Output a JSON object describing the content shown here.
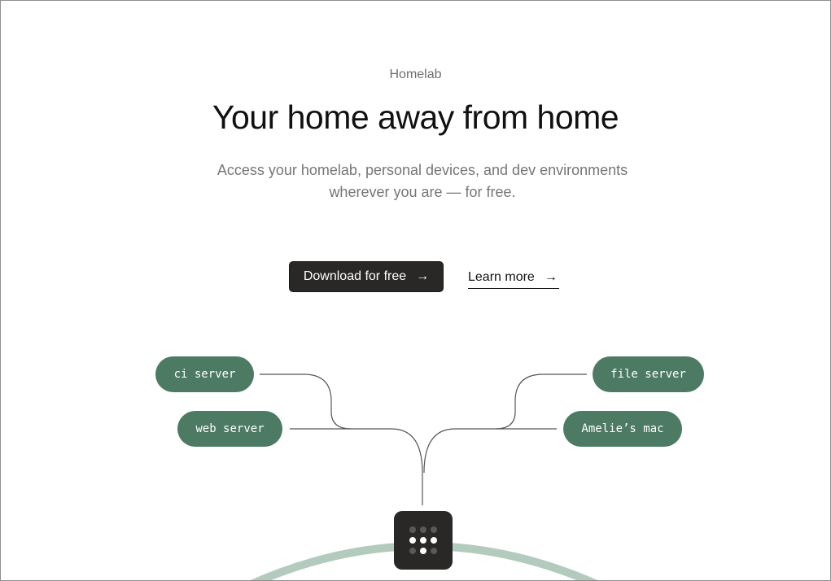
{
  "hero": {
    "eyebrow": "Homelab",
    "title": "Your home away from home",
    "subtitle": "Access your homelab, personal devices, and dev environments wherever you are — for free."
  },
  "actions": {
    "download_label": "Download for free",
    "learn_label": "Learn more",
    "arrow_icon": "arrow-right-icon"
  },
  "network": {
    "nodes": [
      {
        "label": "ci server",
        "side": "left"
      },
      {
        "label": "web server",
        "side": "left"
      },
      {
        "label": "file server",
        "side": "right"
      },
      {
        "label": "Amelie’s mac",
        "side": "right"
      }
    ],
    "hub_icon": "tailscale-logo-icon"
  },
  "colors": {
    "node_fill": "#4d7a62",
    "dark_button": "#2a2727",
    "arc": "#b3cbbd",
    "line": "#555555"
  }
}
